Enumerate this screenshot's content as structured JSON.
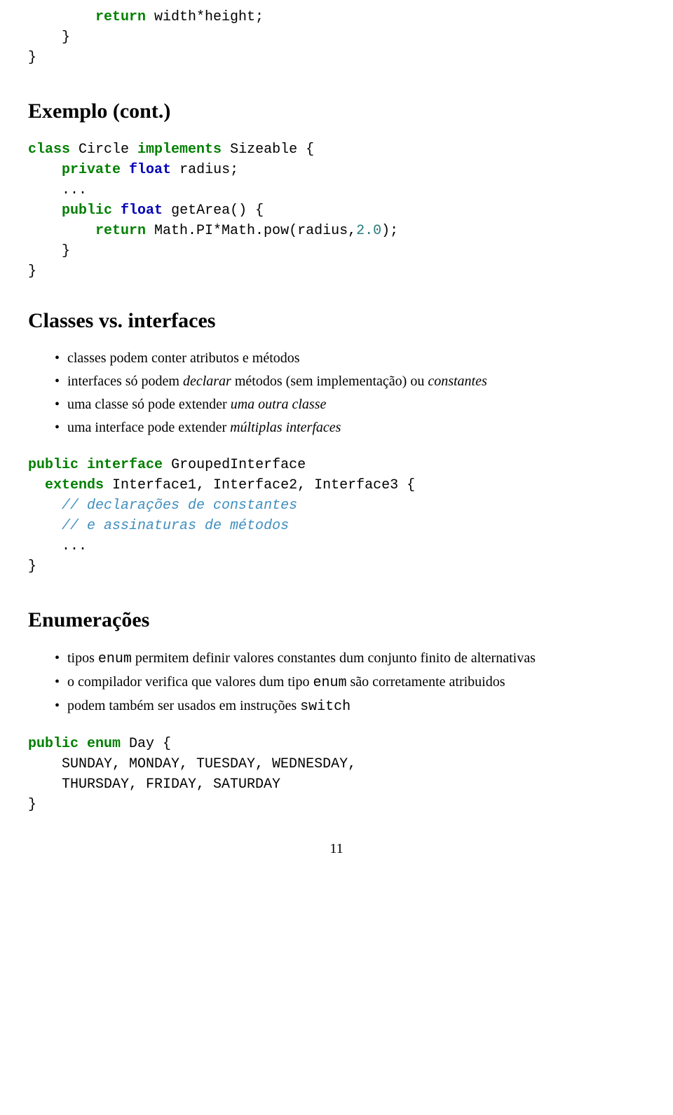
{
  "code1": {
    "l1a": "return",
    "l1b": " width*height;",
    "l2": "    }",
    "l3": "}"
  },
  "h1": "Exemplo (cont.)",
  "code2": {
    "l1a": "class",
    "l1b": " Circle ",
    "l1c": "implements",
    "l1d": " Sizeable {",
    "l2a": "private",
    "l2b": " ",
    "l2c": "float",
    "l2d": " radius;",
    "l3": "...",
    "l4a": "public",
    "l4b": " ",
    "l4c": "float",
    "l4d": " getArea() {",
    "l5a": "return",
    "l5b": " Math.PI*Math.pow(radius,",
    "l5c": "2.0",
    "l5d": ");",
    "l6": "    }",
    "l7": "}"
  },
  "h2": "Classes vs. interfaces",
  "list1": {
    "a": "classes podem conter atributos e métodos",
    "b1": "interfaces só podem ",
    "b2": "declarar",
    "b3": " métodos (sem implementação) ou ",
    "b4": "constantes",
    "c1": "uma classe só pode extender ",
    "c2": "uma outra classe",
    "d1": "uma interface pode extender ",
    "d2": "múltiplas interfaces"
  },
  "code3": {
    "l1a": "public",
    "l1b": " ",
    "l1c": "interface",
    "l1d": " GroupedInterface",
    "l2a": "extends",
    "l2b": " Interface1, Interface2, Interface3 {",
    "l3": "// declarações de constantes",
    "l4": "// e assinaturas de métodos",
    "l5": "    ...",
    "l6": "}"
  },
  "h3": "Enumerações",
  "list2": {
    "a1": "tipos ",
    "a2": "enum",
    "a3": " permitem definir valores constantes dum conjunto finito de alternativas",
    "b1": "o compilador verifica que valores dum tipo ",
    "b2": "enum",
    "b3": " são corretamente atribuidos",
    "c1": "podem também ser usados em instruções ",
    "c2": "switch"
  },
  "code4": {
    "l1a": "public",
    "l1b": " ",
    "l1c": "enum",
    "l1d": " Day {",
    "l2": "    SUNDAY, MONDAY, TUESDAY, WEDNESDAY,",
    "l3": "    THURSDAY, FRIDAY, SATURDAY",
    "l4": "}"
  },
  "page": "11"
}
